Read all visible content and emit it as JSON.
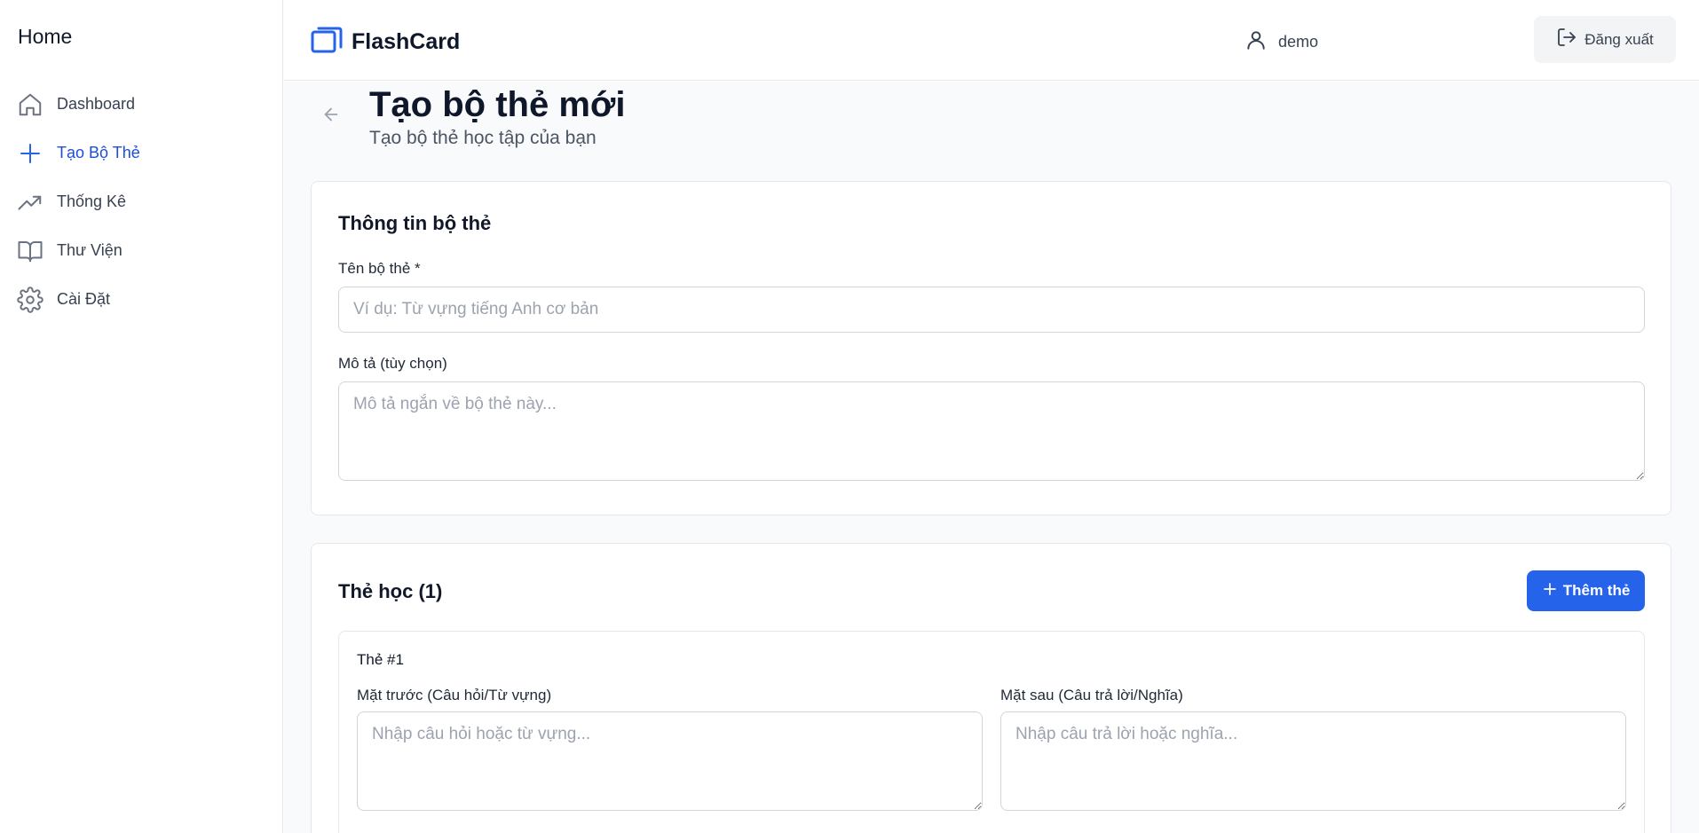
{
  "sidebar": {
    "title": "Home",
    "items": [
      {
        "label": "Dashboard",
        "icon": "home-icon",
        "active": false
      },
      {
        "label": "Tạo Bộ Thẻ",
        "icon": "plus-icon",
        "active": true
      },
      {
        "label": "Thống Kê",
        "icon": "trending-up-icon",
        "active": false
      },
      {
        "label": "Thư Viện",
        "icon": "book-open-icon",
        "active": false
      },
      {
        "label": "Cài Đặt",
        "icon": "gear-icon",
        "active": false
      }
    ]
  },
  "header": {
    "brand": "FlashCard",
    "user_name": "demo",
    "logout_label": "Đăng xuất"
  },
  "page": {
    "title": "Tạo bộ thẻ mới",
    "subtitle": "Tạo bộ thẻ học tập của bạn"
  },
  "deck_info": {
    "heading": "Thông tin bộ thẻ",
    "name_label": "Tên bộ thẻ *",
    "name_placeholder": "Ví dụ: Từ vựng tiếng Anh cơ bản",
    "name_value": "",
    "description_label": "Mô tả (tùy chọn)",
    "description_placeholder": "Mô tả ngắn về bộ thẻ này...",
    "description_value": ""
  },
  "cards_section": {
    "heading": "Thẻ học (1)",
    "add_button_label": "Thêm thẻ",
    "cards": [
      {
        "title": "Thẻ #1",
        "front_label": "Mặt trước (Câu hỏi/Từ vựng)",
        "front_placeholder": "Nhập câu hỏi hoặc từ vựng...",
        "back_label": "Mặt sau (Câu trả lời/Nghĩa)",
        "back_placeholder": "Nhập câu trả lời hoặc nghĩa..."
      }
    ]
  },
  "colors": {
    "accent": "#2563eb",
    "active_nav": "#1d4ed8",
    "main_background": "#f8fafc",
    "border": "#e5e7eb"
  }
}
